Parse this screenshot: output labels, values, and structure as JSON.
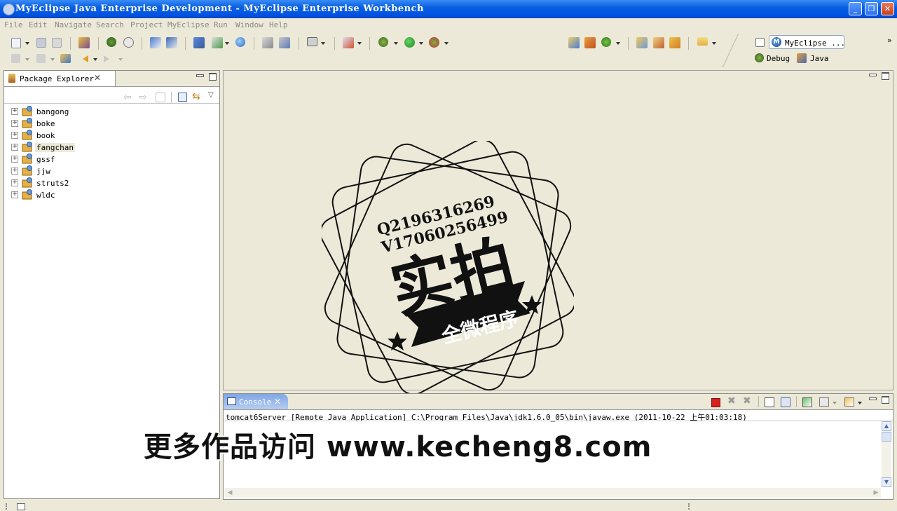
{
  "window": {
    "title": "MyEclipse Java Enterprise Development - MyEclipse Enterprise Workbench",
    "min_glyph": "_",
    "restore_glyph": "❐",
    "close_glyph": "✕"
  },
  "menu": [
    "File",
    "Edit",
    "Navigate",
    "Search",
    "Project",
    "MyEclipse",
    "Run",
    "Window",
    "Help"
  ],
  "perspectives": {
    "current": "MyEclipse ...",
    "others": [
      "Debug",
      "Java"
    ]
  },
  "package_explorer": {
    "tab_label": "Package Explorer",
    "projects": [
      "bangong",
      "boke",
      "book",
      "fangchan",
      "gssf",
      "jjw",
      "struts2",
      "wldc"
    ],
    "selected": "fangchan"
  },
  "stamp": {
    "line1": "Q2196316269",
    "line2": "V17060256499",
    "big": "实拍",
    "ribbon": "全微程序"
  },
  "console": {
    "tab_label": "Console",
    "header": "tomcat6Server [Remote Java Application] C:\\Program Files\\Java\\jdk1.6.0_05\\bin\\javaw.exe (2011-10-22 上午01:03:18)"
  },
  "watermark": "更多作品访问 www.kecheng8.com",
  "colors": {
    "titlebar": "#0054e3",
    "background": "#ece9d8",
    "console_tab": "#7fa6e6",
    "terminate_red": "#d42020"
  }
}
